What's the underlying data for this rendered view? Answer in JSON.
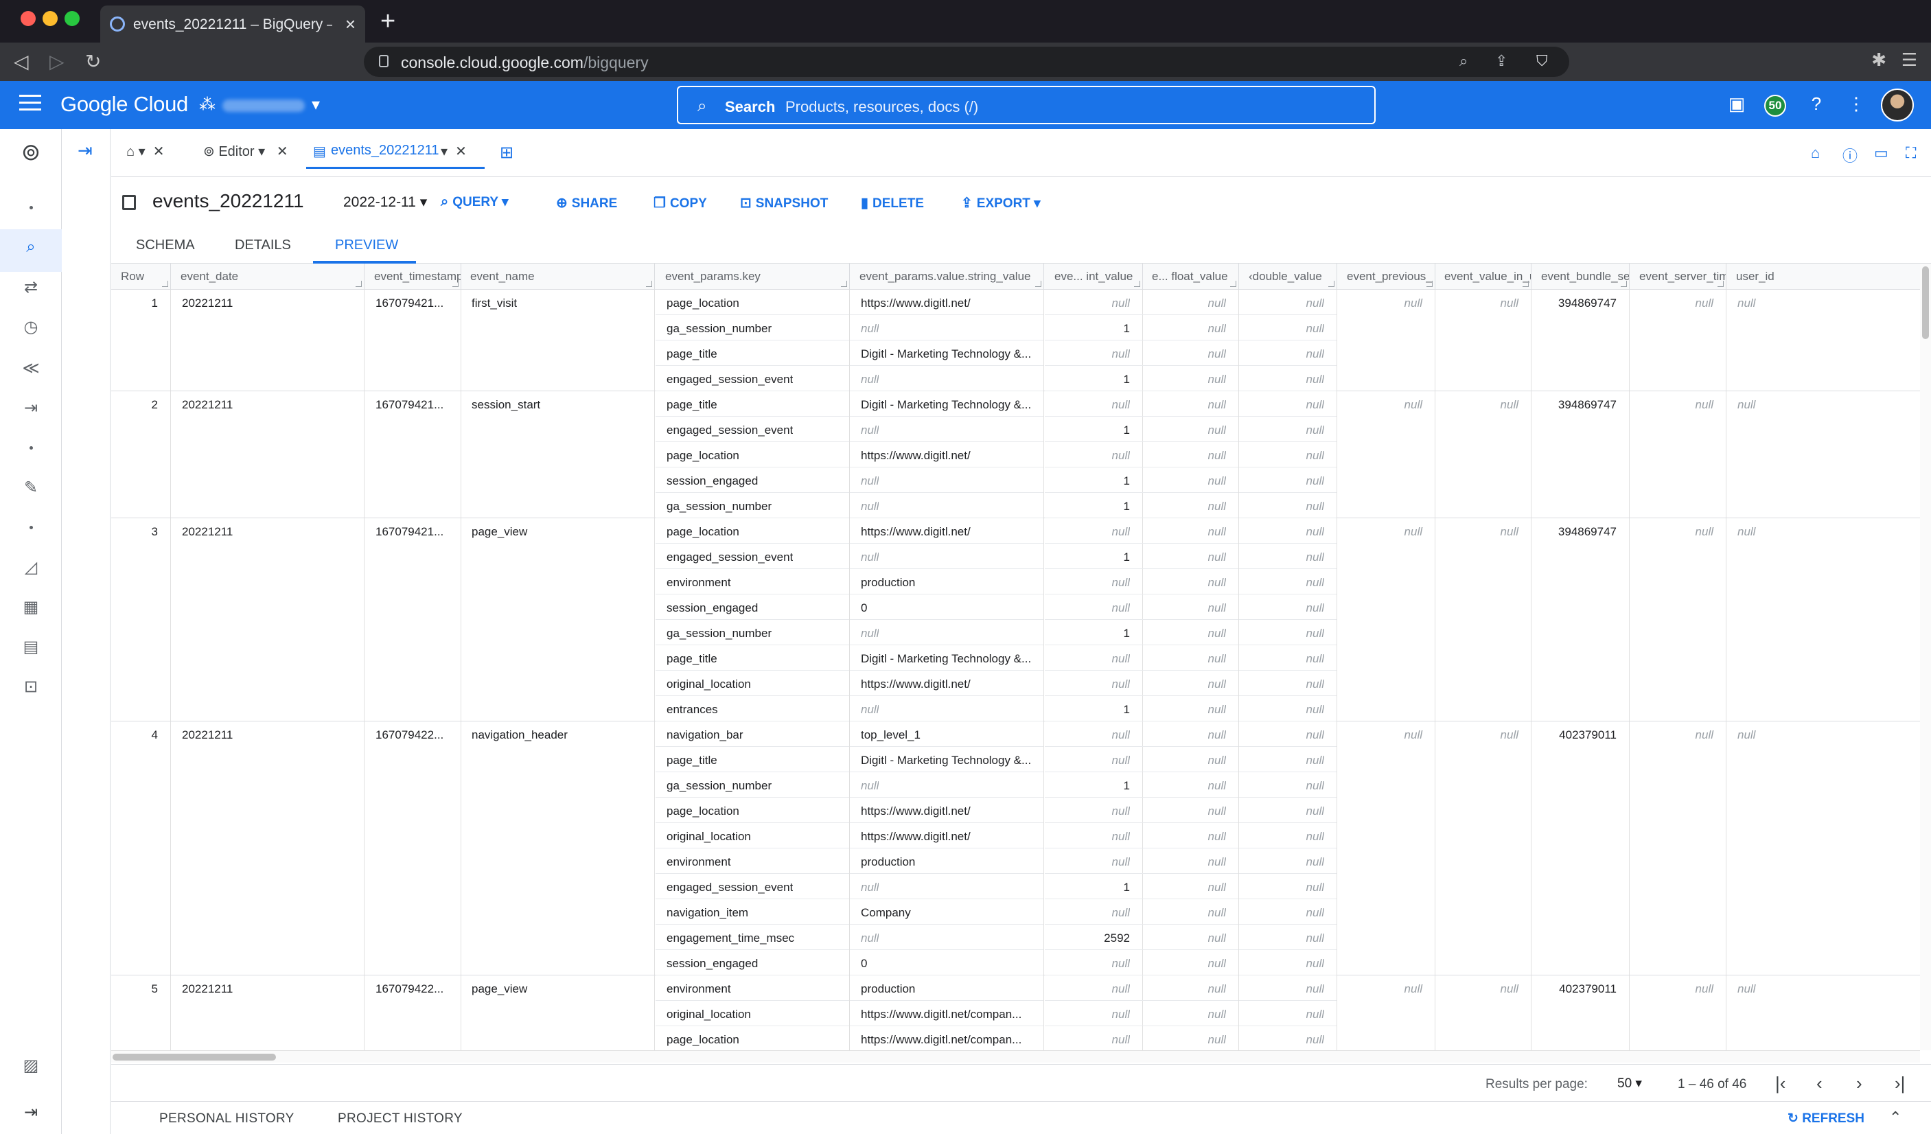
{
  "browser": {
    "tab_title": "events_20221211 – BigQuery –",
    "url_host": "console.cloud.google.com",
    "url_path": "/bigquery",
    "new_tab": "+"
  },
  "header": {
    "logo": "Google Cloud",
    "search_label": "Search",
    "search_placeholder": "Products, resources, docs (/)",
    "badge_count": "50"
  },
  "workspace_tabs": {
    "editor": "Editor",
    "active": "events_20221211"
  },
  "table": {
    "title": "events_20221211",
    "date": "2022-12-11",
    "actions": {
      "query": "QUERY",
      "share": "SHARE",
      "copy": "COPY",
      "snapshot": "SNAPSHOT",
      "delete": "DELETE",
      "export": "EXPORT"
    }
  },
  "subtabs": {
    "schema": "SCHEMA",
    "details": "DETAILS",
    "preview": "PREVIEW"
  },
  "grid": {
    "columns": [
      "Row",
      "event_date",
      "event_timestamp",
      "event_name",
      "event_params.key",
      "event_params.value.string_value",
      "eve... int_value",
      "e... float_value",
      "‹double_value",
      "event_previous_",
      "event_value_in_u",
      "event_bundle_se",
      "event_server_tim",
      "user_id"
    ],
    "null_text": "null",
    "rows": [
      {
        "row": "1",
        "event_date": "20221211",
        "event_timestamp": "167079421...",
        "event_name": "first_visit",
        "previous": "null",
        "value_in_usd": "null",
        "bundle": "394869747",
        "server_time": "null",
        "user_id": "null",
        "params": [
          {
            "key": "page_location",
            "string": "https://www.digitl.net/",
            "int": "null"
          },
          {
            "key": "ga_session_number",
            "string": "null",
            "int": "1"
          },
          {
            "key": "page_title",
            "string": "Digitl - Marketing Technology &...",
            "int": "null"
          },
          {
            "key": "engaged_session_event",
            "string": "null",
            "int": "1"
          }
        ]
      },
      {
        "row": "2",
        "event_date": "20221211",
        "event_timestamp": "167079421...",
        "event_name": "session_start",
        "previous": "null",
        "value_in_usd": "null",
        "bundle": "394869747",
        "server_time": "null",
        "user_id": "null",
        "params": [
          {
            "key": "page_title",
            "string": "Digitl - Marketing Technology &...",
            "int": "null"
          },
          {
            "key": "engaged_session_event",
            "string": "null",
            "int": "1"
          },
          {
            "key": "page_location",
            "string": "https://www.digitl.net/",
            "int": "null"
          },
          {
            "key": "session_engaged",
            "string": "null",
            "int": "1"
          },
          {
            "key": "ga_session_number",
            "string": "null",
            "int": "1"
          }
        ]
      },
      {
        "row": "3",
        "event_date": "20221211",
        "event_timestamp": "167079421...",
        "event_name": "page_view",
        "previous": "null",
        "value_in_usd": "null",
        "bundle": "394869747",
        "server_time": "null",
        "user_id": "null",
        "params": [
          {
            "key": "page_location",
            "string": "https://www.digitl.net/",
            "int": "null"
          },
          {
            "key": "engaged_session_event",
            "string": "null",
            "int": "1"
          },
          {
            "key": "environment",
            "string": "production",
            "int": "null"
          },
          {
            "key": "session_engaged",
            "string": "0",
            "int": "null"
          },
          {
            "key": "ga_session_number",
            "string": "null",
            "int": "1"
          },
          {
            "key": "page_title",
            "string": "Digitl - Marketing Technology &...",
            "int": "null"
          },
          {
            "key": "original_location",
            "string": "https://www.digitl.net/",
            "int": "null"
          },
          {
            "key": "entrances",
            "string": "null",
            "int": "1"
          }
        ]
      },
      {
        "row": "4",
        "event_date": "20221211",
        "event_timestamp": "167079422...",
        "event_name": "navigation_header",
        "previous": "null",
        "value_in_usd": "null",
        "bundle": "402379011",
        "server_time": "null",
        "user_id": "null",
        "params": [
          {
            "key": "navigation_bar",
            "string": "top_level_1",
            "int": "null"
          },
          {
            "key": "page_title",
            "string": "Digitl - Marketing Technology &...",
            "int": "null"
          },
          {
            "key": "ga_session_number",
            "string": "null",
            "int": "1"
          },
          {
            "key": "page_location",
            "string": "https://www.digitl.net/",
            "int": "null"
          },
          {
            "key": "original_location",
            "string": "https://www.digitl.net/",
            "int": "null"
          },
          {
            "key": "environment",
            "string": "production",
            "int": "null"
          },
          {
            "key": "engaged_session_event",
            "string": "null",
            "int": "1"
          },
          {
            "key": "navigation_item",
            "string": "Company",
            "int": "null"
          },
          {
            "key": "engagement_time_msec",
            "string": "null",
            "int": "2592"
          },
          {
            "key": "session_engaged",
            "string": "0",
            "int": "null"
          }
        ]
      },
      {
        "row": "5",
        "event_date": "20221211",
        "event_timestamp": "167079422...",
        "event_name": "page_view",
        "previous": "null",
        "value_in_usd": "null",
        "bundle": "402379011",
        "server_time": "null",
        "user_id": "null",
        "params": [
          {
            "key": "environment",
            "string": "production",
            "int": "null"
          },
          {
            "key": "original_location",
            "string": "https://www.digitl.net/compan...",
            "int": "null"
          },
          {
            "key": "page_location",
            "string": "https://www.digitl.net/compan...",
            "int": "null"
          }
        ]
      }
    ]
  },
  "pager": {
    "results_label": "Results per page:",
    "per_page": "50",
    "range": "1 – 46 of 46"
  },
  "history": {
    "personal": "PERSONAL HISTORY",
    "project": "PROJECT HISTORY",
    "refresh": "REFRESH"
  },
  "colors": {
    "brand": "#1a73e8",
    "null": "#9aa0a6"
  }
}
